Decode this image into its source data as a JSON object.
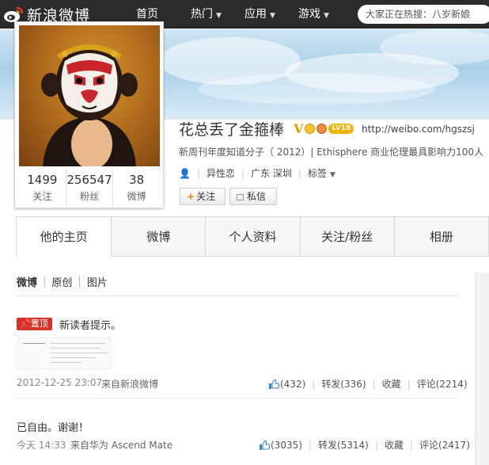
{
  "topbar": {
    "logo_text": "新浪微博",
    "nav": [
      {
        "label": "首页",
        "has_caret": false
      },
      {
        "label": "热门",
        "has_caret": true
      },
      {
        "label": "应用",
        "has_caret": true
      },
      {
        "label": "游戏",
        "has_caret": true
      }
    ],
    "search_placeholder": "大家正在热搜：八岁新娘"
  },
  "profile": {
    "name": "花总丢了金箍棒",
    "verified_mark": "V",
    "level_badge": "LV18",
    "url": "http://weibo.com/hgszsj",
    "bio": "新周刊年度知道分子（ 2012）| Ethisphere 商业伦理最具影响力100人（",
    "orientation": "异性恋",
    "location": "广东 深圳",
    "tags_label": "标签",
    "follow_button": "关注",
    "message_button": "私信",
    "stats": [
      {
        "value": "1499",
        "label": "关注"
      },
      {
        "value": "256547",
        "label": "粉丝"
      },
      {
        "value": "38",
        "label": "微博"
      }
    ]
  },
  "tabs": [
    "他的主页",
    "微博",
    "个人资料",
    "关注/粉丝",
    "相册"
  ],
  "feed": {
    "subnav": [
      "微博",
      "原创",
      "图片"
    ],
    "posts": [
      {
        "pin_label": "置顶",
        "text": "新读者提示。",
        "time": "2012-12-25 23:07",
        "source": "来自新浪微博",
        "likes": "(432)",
        "repost": "转发(336)",
        "favorite": "收藏",
        "comment": "评论(2214)"
      },
      {
        "text": "已自由。谢谢！",
        "time": "今天 14:33",
        "source": "来自华为 Ascend Mate",
        "likes": "(3035)",
        "repost": "转发(5314)",
        "favorite": "收藏",
        "comment": "评论(2417)"
      }
    ]
  },
  "colors": {
    "topbar": "#2b2b2b",
    "pin": "#d9322b",
    "follow_plus": "#f28500",
    "link_blue": "#3a87c8"
  }
}
